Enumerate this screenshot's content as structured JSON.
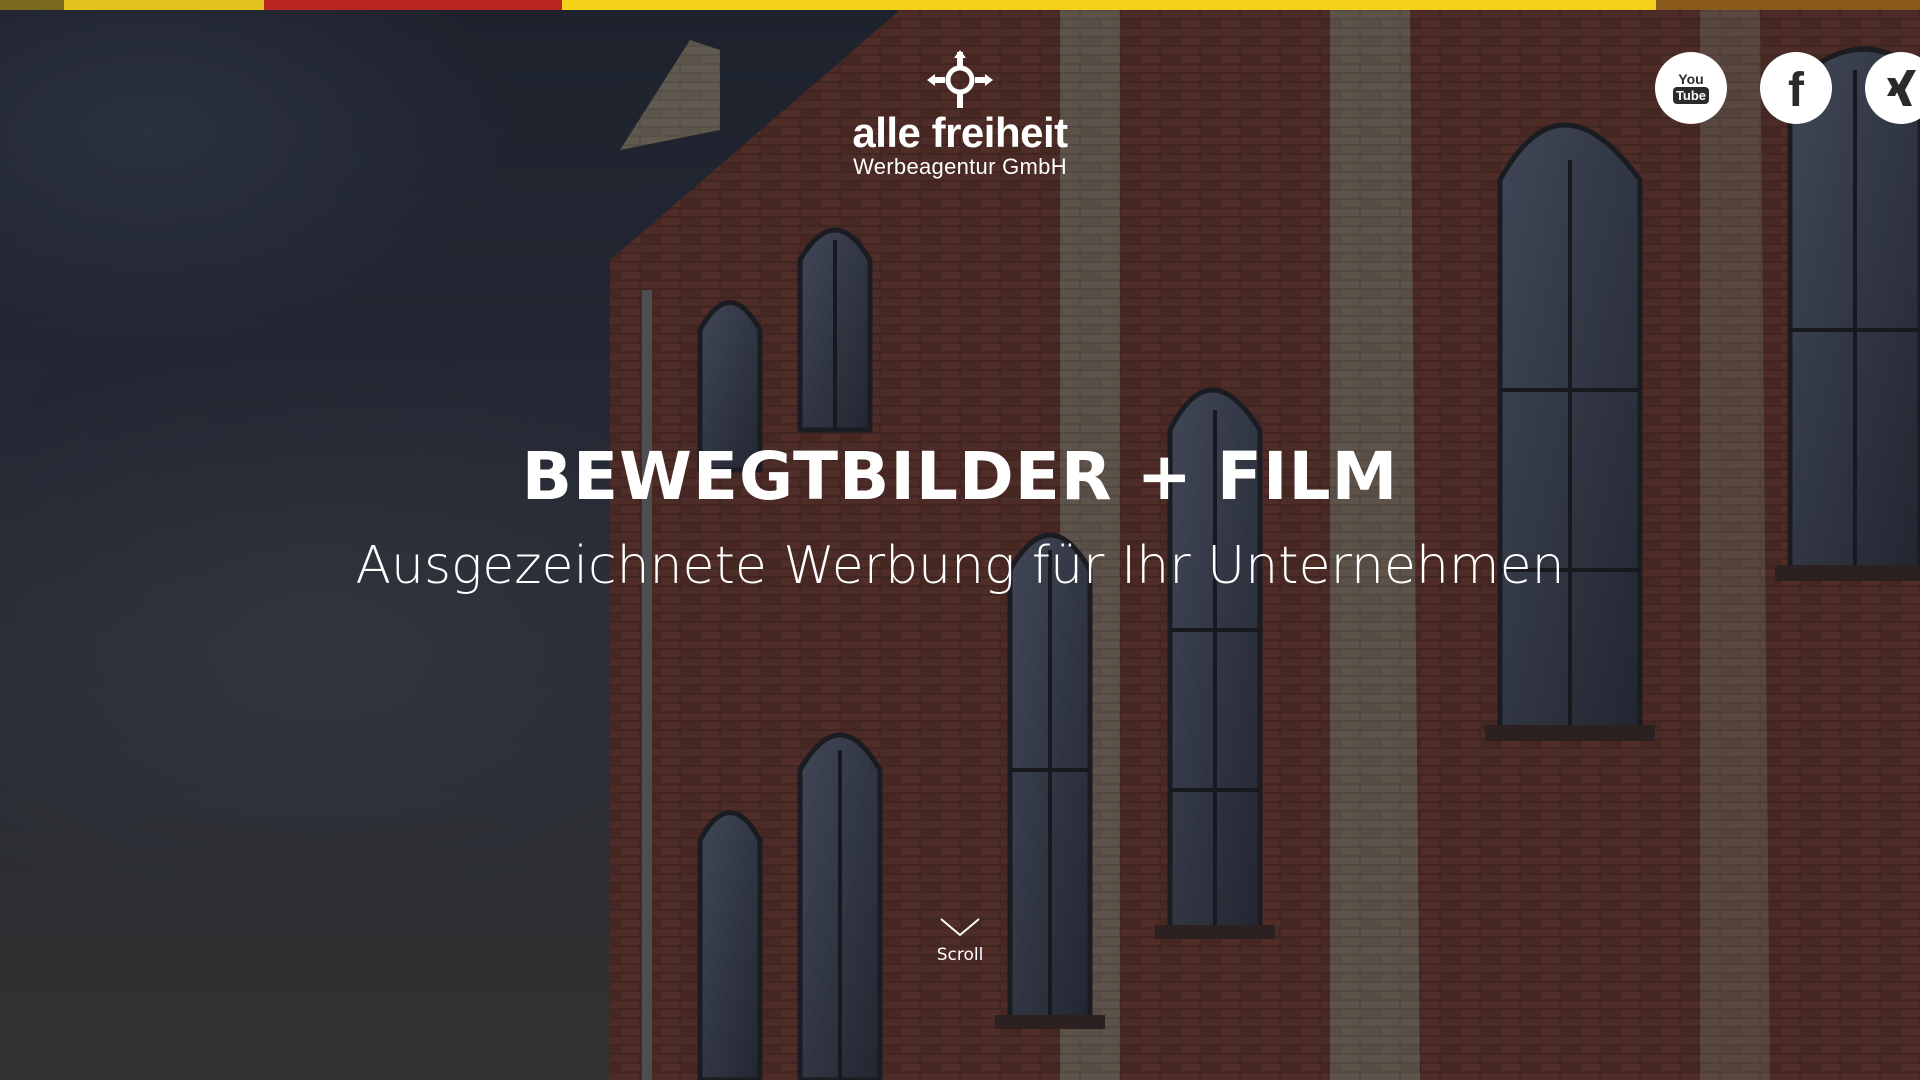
{
  "topbar": {
    "segments": [
      {
        "color": "#7a6a1f",
        "width": 64
      },
      {
        "color": "#e2c21d",
        "width": 200
      },
      {
        "color": "#b8261f",
        "width": 298
      },
      {
        "color": "#f5d21a",
        "width": 1094
      },
      {
        "color": "#8a5a1c",
        "width": 264
      }
    ]
  },
  "logo": {
    "name": "alle freiheit",
    "subtitle": "Werbeagentur GmbH",
    "icon": "compass-cross-icon"
  },
  "social": {
    "youtube": {
      "icon": "youtube-icon",
      "you": "You",
      "tube": "Tube"
    },
    "facebook": {
      "icon": "facebook-icon",
      "glyph": "f"
    },
    "xing": {
      "icon": "xing-icon"
    }
  },
  "hero": {
    "headline": "BEWEGTBILDER + FILM",
    "subline": "Ausgezeichnete Werbung für Ihr Unternehmen"
  },
  "scroll": {
    "label": "Scroll",
    "icon": "chevron-down-icon"
  }
}
